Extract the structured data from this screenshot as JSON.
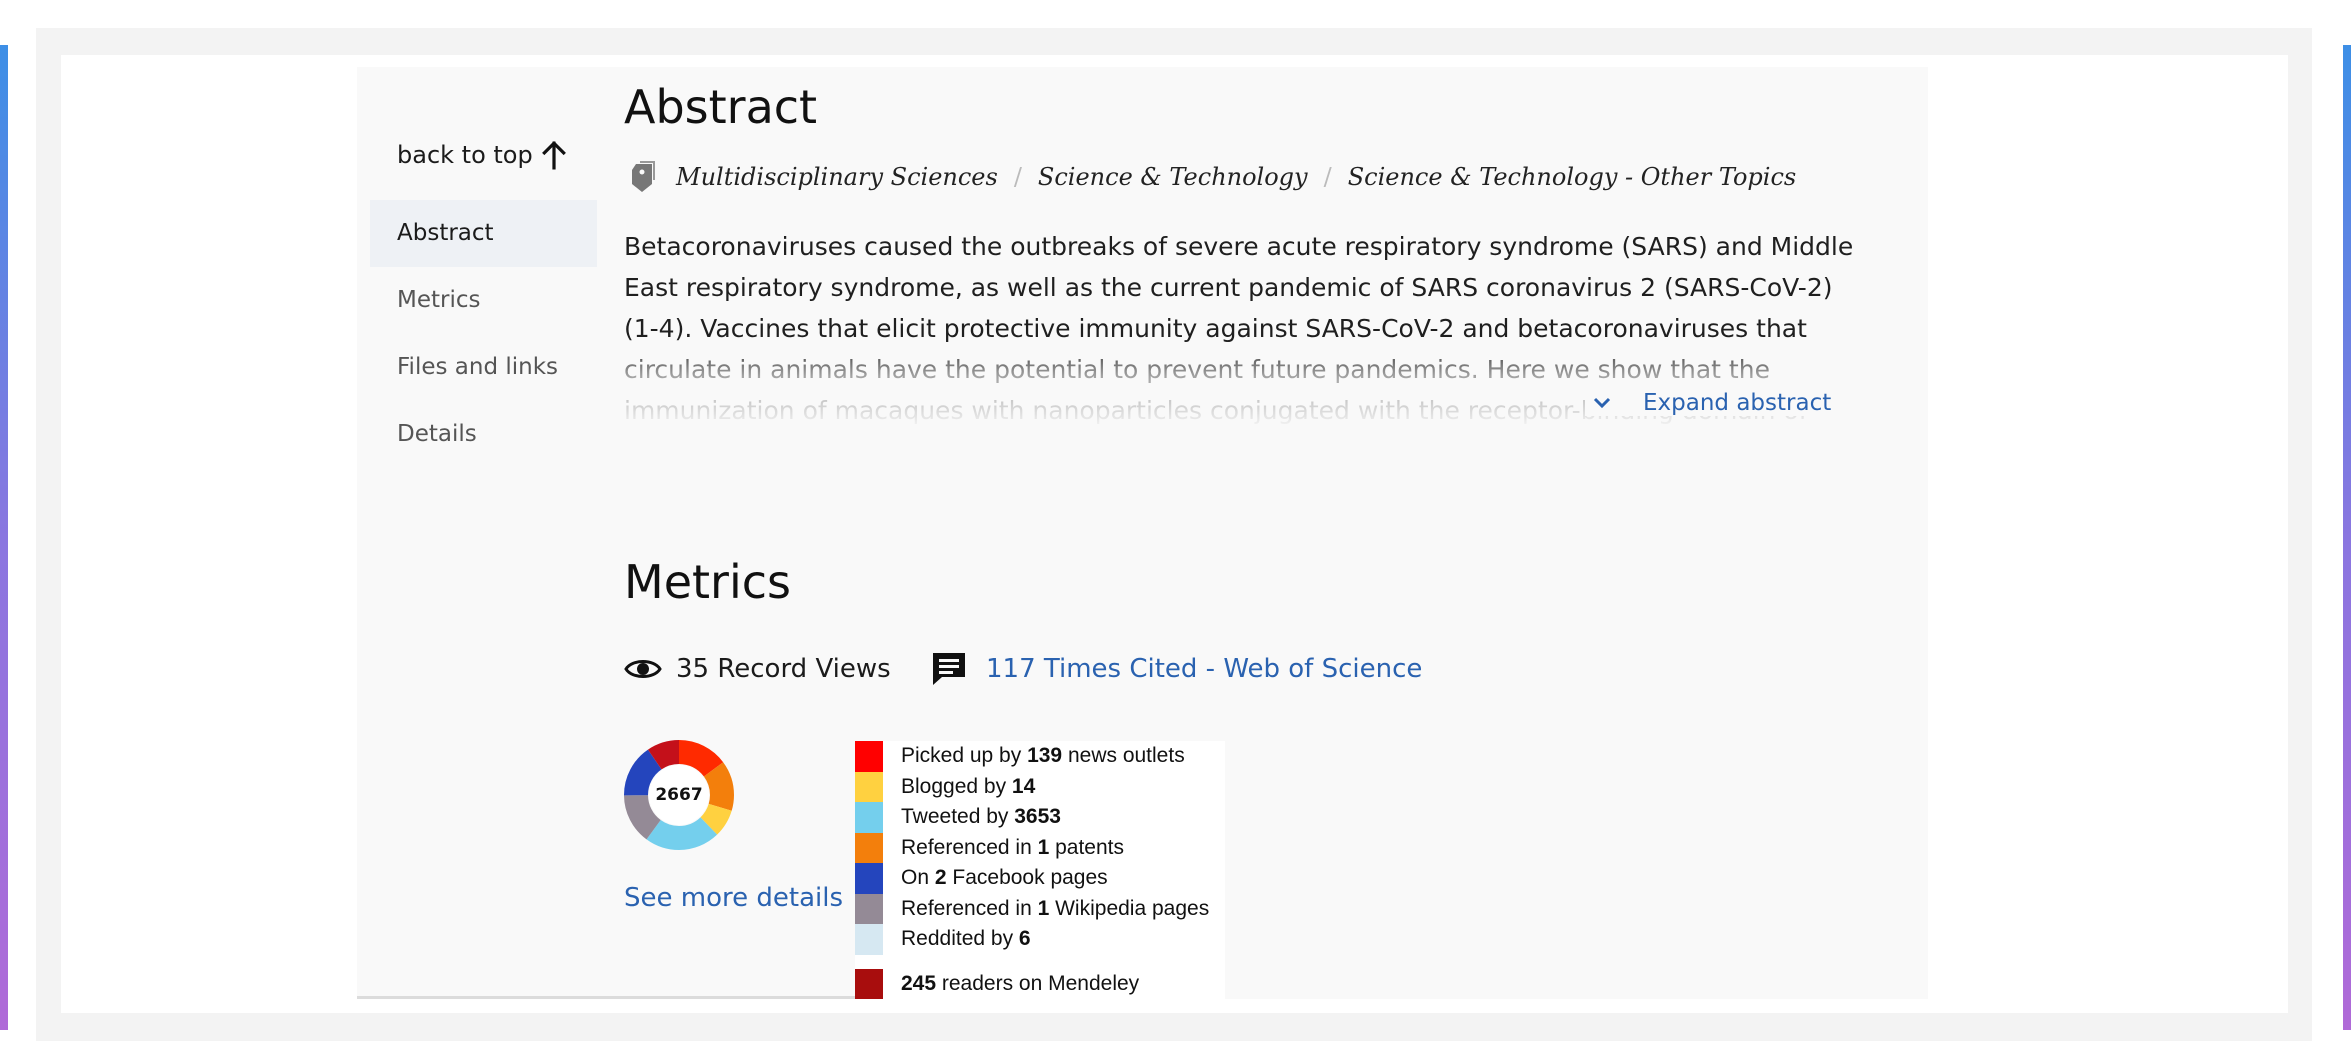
{
  "nav": {
    "back_to_top": "back to top",
    "items": [
      {
        "label": "Abstract",
        "active": true
      },
      {
        "label": "Metrics",
        "active": false
      },
      {
        "label": "Files and links",
        "active": false
      },
      {
        "label": "Details",
        "active": false
      }
    ]
  },
  "abstract": {
    "heading": "Abstract",
    "categories": [
      "Multidisciplinary Sciences",
      "Science & Technology",
      "Science & Technology - Other Topics"
    ],
    "category_separator": "/",
    "text": "Betacoronaviruses caused the outbreaks of severe acute respiratory syndrome (SARS) and Middle East respiratory syndrome, as well as the current pandemic of SARS coronavirus 2 (SARS-CoV-2)(1-4). Vaccines that elicit protective immunity against SARS-CoV-2 and betacoronaviruses that circulate in animals have the potential to prevent future pandemics. Here we show that the immunization of macaques with nanoparticles conjugated with the receptor-binding domain of",
    "expand_label": "Expand abstract"
  },
  "metrics": {
    "heading": "Metrics",
    "record_views": "35 Record Views",
    "times_cited": "117 Times Cited - Web of Science",
    "altmetric_score": "2667",
    "see_more": "See more details",
    "legend": [
      {
        "pre": "Picked up by ",
        "num": "139",
        "post": " news outlets",
        "color": "#ff0000"
      },
      {
        "pre": "Blogged by ",
        "num": "14",
        "post": "",
        "color": "#ffd140"
      },
      {
        "pre": "Tweeted by ",
        "num": "3653",
        "post": "",
        "color": "#74cfed"
      },
      {
        "pre": "Referenced in ",
        "num": "1",
        "post": " patents",
        "color": "#f37f0c"
      },
      {
        "pre": "On ",
        "num": "2",
        "post": " Facebook pages",
        "color": "#2445bd"
      },
      {
        "pre": "Referenced in ",
        "num": "1",
        "post": " Wikipedia pages",
        "color": "#948a96"
      },
      {
        "pre": "Reddited by ",
        "num": "6",
        "post": "",
        "color": "#d6e8f2"
      }
    ],
    "mendeley": {
      "num": "245",
      "post": " readers on Mendeley",
      "color": "#a80d0d"
    }
  },
  "icons": {
    "back_to_top": "arrow-up-icon",
    "categories": "tag-icon",
    "expand": "chevron-down-icon",
    "views": "eye-icon",
    "cited": "comment-icon"
  },
  "colors": {
    "link": "#2a62b0",
    "panel_bg": "#f9f9f9",
    "nav_active_bg": "#eef1f5"
  }
}
